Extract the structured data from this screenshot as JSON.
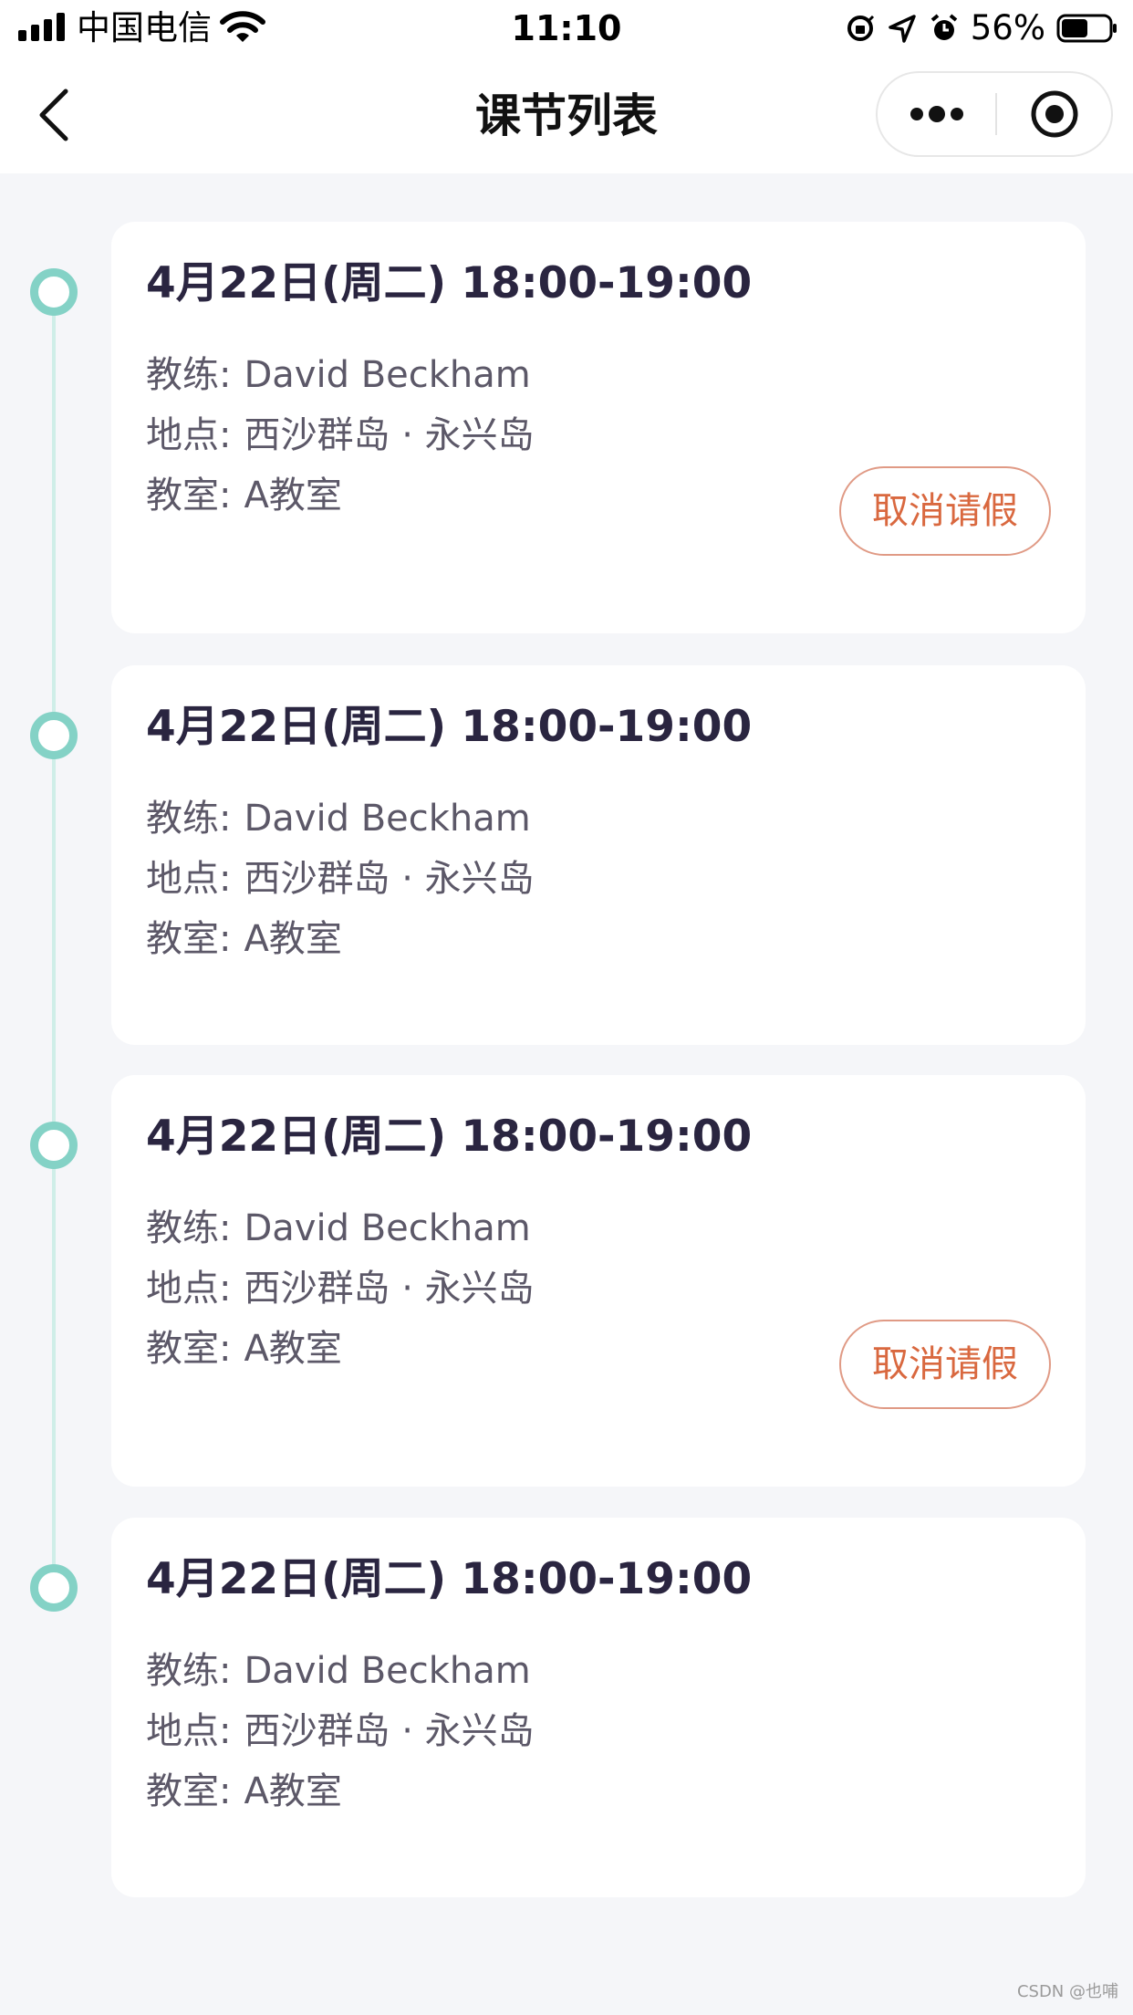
{
  "status_bar": {
    "carrier": "中国电信",
    "time": "11:10",
    "battery_percent": "56%",
    "battery_level": 0.56,
    "icons": [
      "signal-icon",
      "wifi-icon",
      "orientation-lock-icon",
      "location-icon",
      "alarm-icon",
      "battery-icon"
    ]
  },
  "nav": {
    "title": "课节列表",
    "back_icon": "chevron-left-icon",
    "more_icon": "more-dots-icon",
    "close_icon": "target-close-icon"
  },
  "colors": {
    "timeline_accent": "#84d2c6",
    "cancel_button": "#d9683f",
    "title_text": "#2a2540",
    "background": "#f5f6f9"
  },
  "lessons": [
    {
      "time": "4月22日(周二) 18:00-19:00",
      "coach_label": "教练:",
      "coach": "David Beckham",
      "location_label": "地点:",
      "location": "西沙群岛 · 永兴岛",
      "room_label": "教室:",
      "room": "A教室",
      "action": "取消请假"
    },
    {
      "time": "4月22日(周二) 18:00-19:00",
      "coach_label": "教练:",
      "coach": "David Beckham",
      "location_label": "地点:",
      "location": "西沙群岛 · 永兴岛",
      "room_label": "教室:",
      "room": "A教室"
    },
    {
      "time": "4月22日(周二) 18:00-19:00",
      "coach_label": "教练:",
      "coach": "David Beckham",
      "location_label": "地点:",
      "location": "西沙群岛 · 永兴岛",
      "room_label": "教室:",
      "room": "A教室",
      "action": "取消请假"
    },
    {
      "time": "4月22日(周二) 18:00-19:00",
      "coach_label": "教练:",
      "coach": "David Beckham",
      "location_label": "地点:",
      "location": "西沙群岛 · 永兴岛",
      "room_label": "教室:",
      "room": "A教室"
    }
  ],
  "watermark": "CSDN @也哺"
}
